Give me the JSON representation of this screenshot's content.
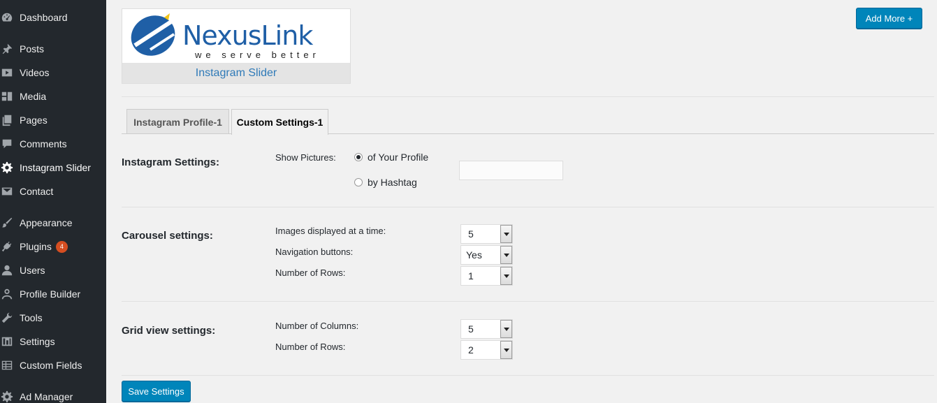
{
  "sidebar": {
    "items": [
      {
        "label": "Dashboard",
        "icon": "dashboard-icon"
      },
      {
        "label": "Posts",
        "icon": "pin-icon"
      },
      {
        "label": "Videos",
        "icon": "video-icon"
      },
      {
        "label": "Media",
        "icon": "media-icon"
      },
      {
        "label": "Pages",
        "icon": "pages-icon"
      },
      {
        "label": "Comments",
        "icon": "comment-icon"
      },
      {
        "label": "Instagram Slider",
        "icon": "gear-icon"
      },
      {
        "label": "Contact",
        "icon": "mail-icon"
      },
      {
        "label": "Appearance",
        "icon": "brush-icon"
      },
      {
        "label": "Plugins",
        "icon": "plug-icon",
        "badge": "4"
      },
      {
        "label": "Users",
        "icon": "users-icon"
      },
      {
        "label": "Profile Builder",
        "icon": "person-icon"
      },
      {
        "label": "Tools",
        "icon": "wrench-icon"
      },
      {
        "label": "Settings",
        "icon": "settings-icon"
      },
      {
        "label": "Custom Fields",
        "icon": "grid-icon"
      },
      {
        "label": "Ad Manager",
        "icon": "gear-icon"
      }
    ]
  },
  "header": {
    "add_more_label": "Add More +",
    "logo_brand": "NexusLink",
    "logo_tagline": "we serve better",
    "logo_caption": "Instagram Slider"
  },
  "tabs": [
    {
      "label": "Instagram Profile-1",
      "active": false
    },
    {
      "label": "Custom Settings-1",
      "active": true
    }
  ],
  "instagram": {
    "title": "Instagram Settings:",
    "show_pictures_label": "Show Pictures:",
    "option_profile": "of Your Profile",
    "option_hashtag": "by Hashtag",
    "selected": "profile",
    "hashtag_value": ""
  },
  "carousel": {
    "title": "Carousel settings:",
    "images_label": "Images displayed at a time:",
    "images_value": "5",
    "nav_label": "Navigation buttons:",
    "nav_value": "Yes",
    "rows_label": "Number of Rows:",
    "rows_value": "1"
  },
  "grid": {
    "title": "Grid view settings:",
    "columns_label": "Number of Columns:",
    "columns_value": "5",
    "rows_label": "Number of Rows:",
    "rows_value": "2"
  },
  "footer": {
    "save_label": "Save Settings"
  },
  "colors": {
    "sidebar_bg": "#23282d",
    "primary": "#0085ba",
    "badge": "#d54e21",
    "logo_blue": "#1f5fa6"
  }
}
